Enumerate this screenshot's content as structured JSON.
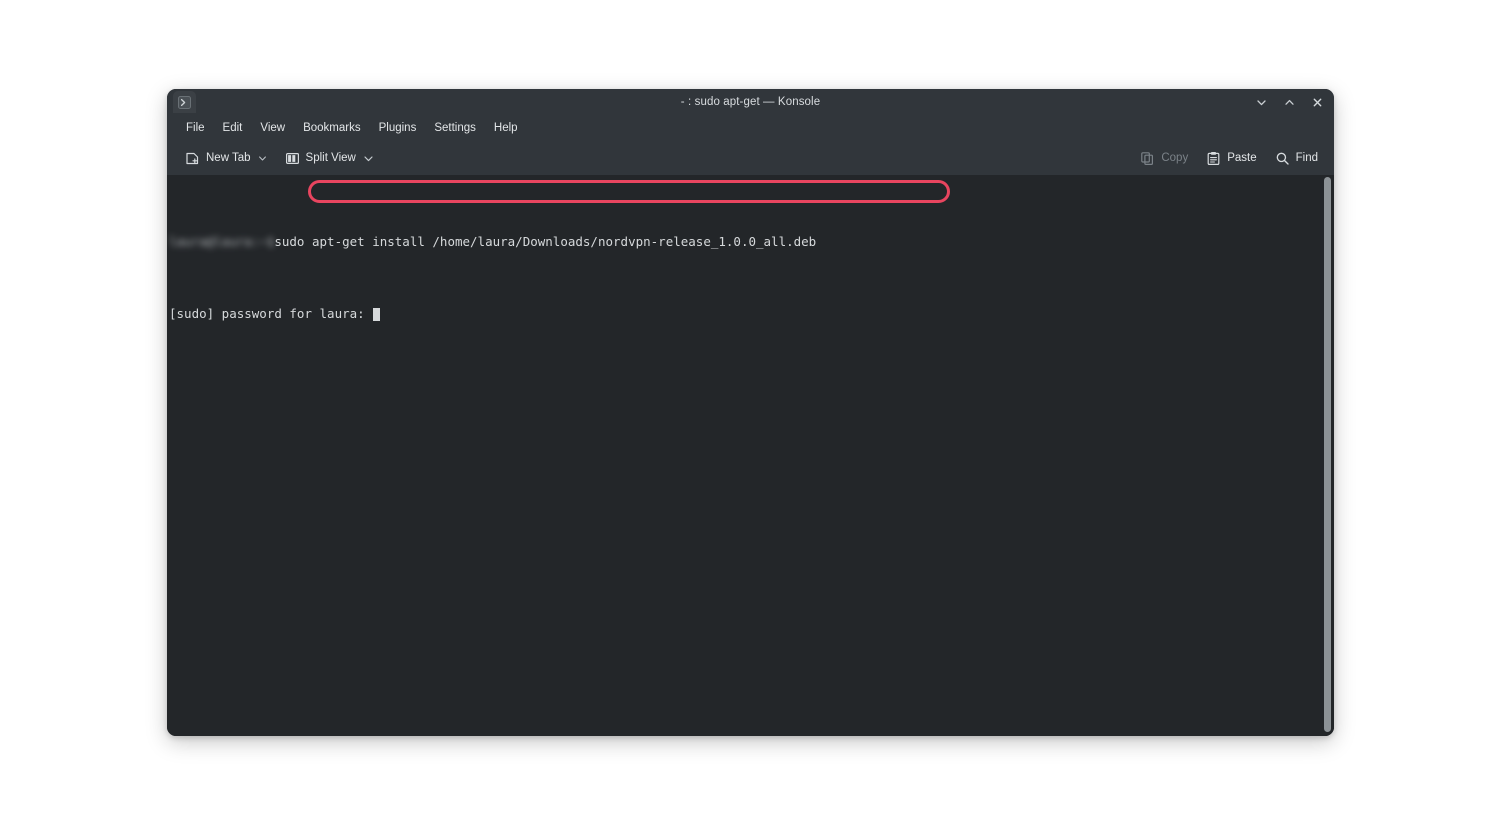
{
  "window": {
    "title": "- : sudo apt-get — Konsole",
    "app_icon": "terminal-prompt-icon",
    "controls": {
      "minimize": "minimize",
      "maximize": "maximize",
      "close": "close"
    }
  },
  "menubar": {
    "items": [
      {
        "label": "File"
      },
      {
        "label": "Edit"
      },
      {
        "label": "View"
      },
      {
        "label": "Bookmarks"
      },
      {
        "label": "Plugins"
      },
      {
        "label": "Settings"
      },
      {
        "label": "Help"
      }
    ]
  },
  "toolbar": {
    "left": [
      {
        "label": "New Tab",
        "icon": "new-tab-icon",
        "has_caret": true,
        "disabled": false
      },
      {
        "label": "Split View",
        "icon": "split-view-icon",
        "has_caret": true,
        "disabled": false
      }
    ],
    "right": [
      {
        "label": "Copy",
        "icon": "copy-icon",
        "disabled": true
      },
      {
        "label": "Paste",
        "icon": "paste-icon",
        "disabled": false
      },
      {
        "label": "Find",
        "icon": "search-icon",
        "disabled": false
      }
    ]
  },
  "terminal": {
    "prompt_redacted": "laura@laura:~$",
    "command": "sudo apt-get install /home/laura/Downloads/nordvpn-release_1.0.0_all.deb",
    "password_prompt": "[sudo] password for laura: ",
    "cursor": "block"
  },
  "annotation": {
    "shape": "rounded-rectangle-highlight",
    "color": "#e8455f",
    "targets": "terminal-command"
  },
  "colors": {
    "titlebar_bg": "#31363b",
    "terminal_bg": "#232629",
    "text": "#e3e6e8",
    "disabled_text": "#7b8288",
    "annotation": "#e8455f",
    "scrollbar": "#8c9296"
  }
}
